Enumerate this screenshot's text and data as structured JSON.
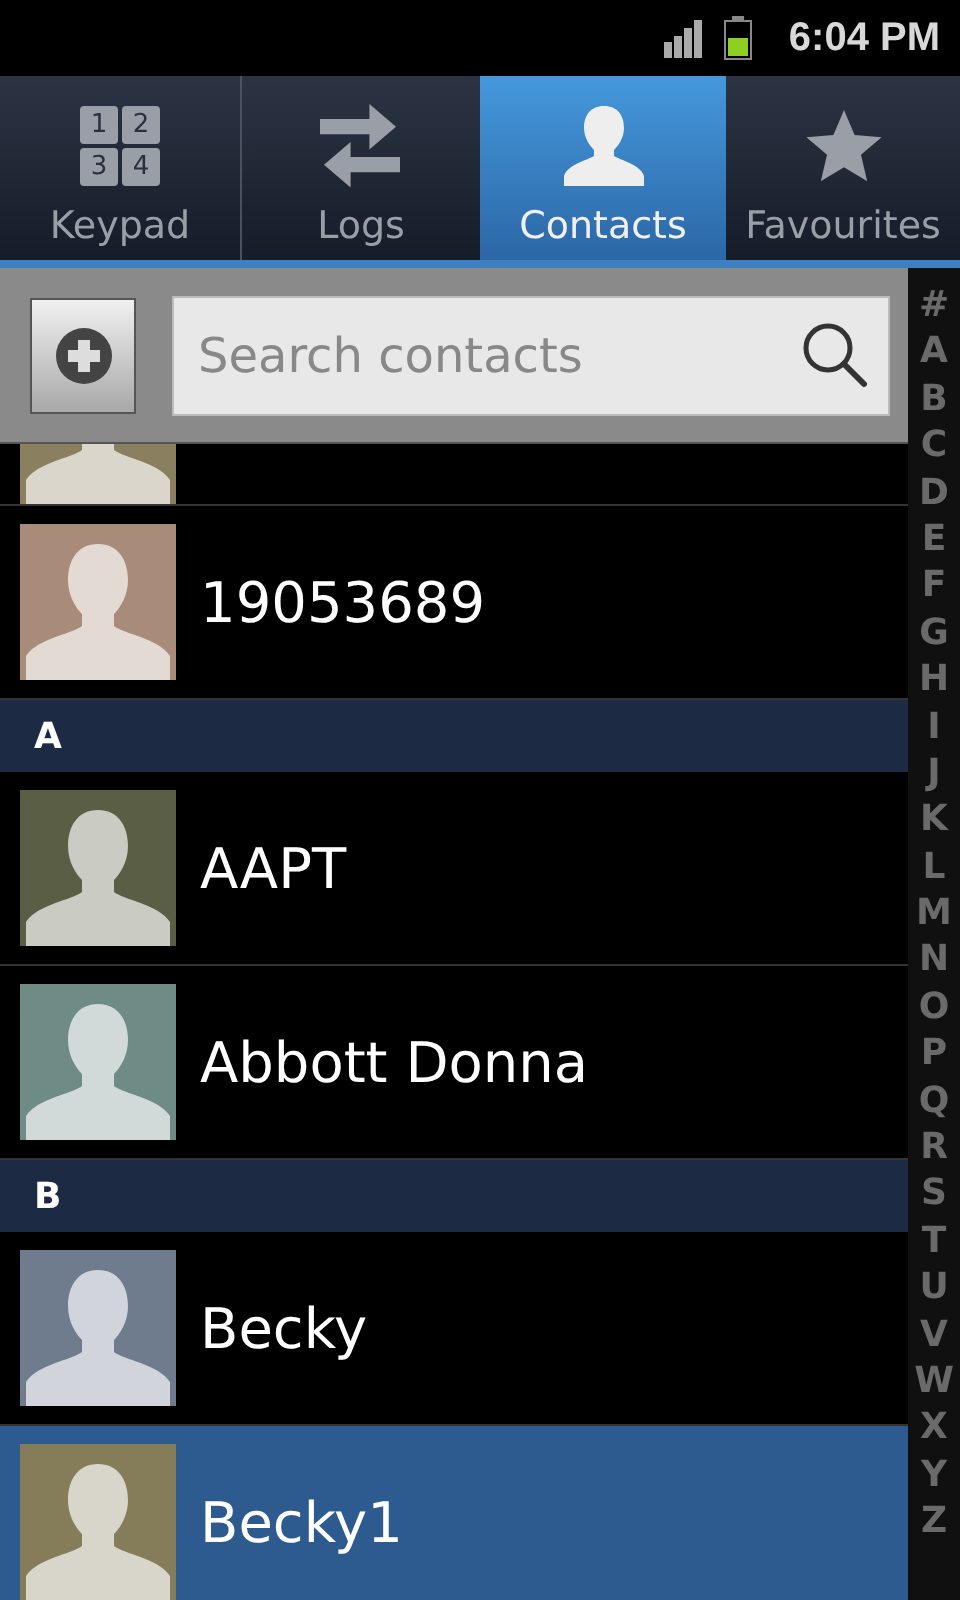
{
  "status_bar": {
    "time": "6:04 PM"
  },
  "tabs": [
    {
      "label": "Keypad",
      "kind": "keypad",
      "selected": false,
      "keys": [
        "1",
        "2",
        "3",
        "4"
      ]
    },
    {
      "label": "Logs",
      "kind": "logs",
      "selected": false
    },
    {
      "label": "Contacts",
      "kind": "contacts",
      "selected": true
    },
    {
      "label": "Favourites",
      "kind": "favourites",
      "selected": false
    }
  ],
  "search": {
    "placeholder": "Search contacts"
  },
  "list": [
    {
      "kind": "contact",
      "color": "#8a7f5f",
      "selected": false
    },
    {
      "kind": "contact",
      "name": "19053689",
      "color": "#a98b7a",
      "selected": false
    },
    {
      "kind": "header",
      "label": "A"
    },
    {
      "kind": "contact",
      "name": "AAPT",
      "color": "#5a5e45",
      "selected": false
    },
    {
      "kind": "contact",
      "name": "Abbott Donna",
      "color": "#6e8b86",
      "selected": false
    },
    {
      "kind": "header",
      "label": "B"
    },
    {
      "kind": "contact",
      "name": "Becky",
      "color": "#6f7c8e",
      "selected": false
    },
    {
      "kind": "contact",
      "name": "Becky1",
      "color": "#857c5a",
      "selected": true
    }
  ],
  "index": [
    "#",
    "A",
    "B",
    "C",
    "D",
    "E",
    "F",
    "G",
    "H",
    "I",
    "J",
    "K",
    "L",
    "M",
    "N",
    "O",
    "P",
    "Q",
    "R",
    "S",
    "T",
    "U",
    "V",
    "W",
    "X",
    "Y",
    "Z"
  ]
}
